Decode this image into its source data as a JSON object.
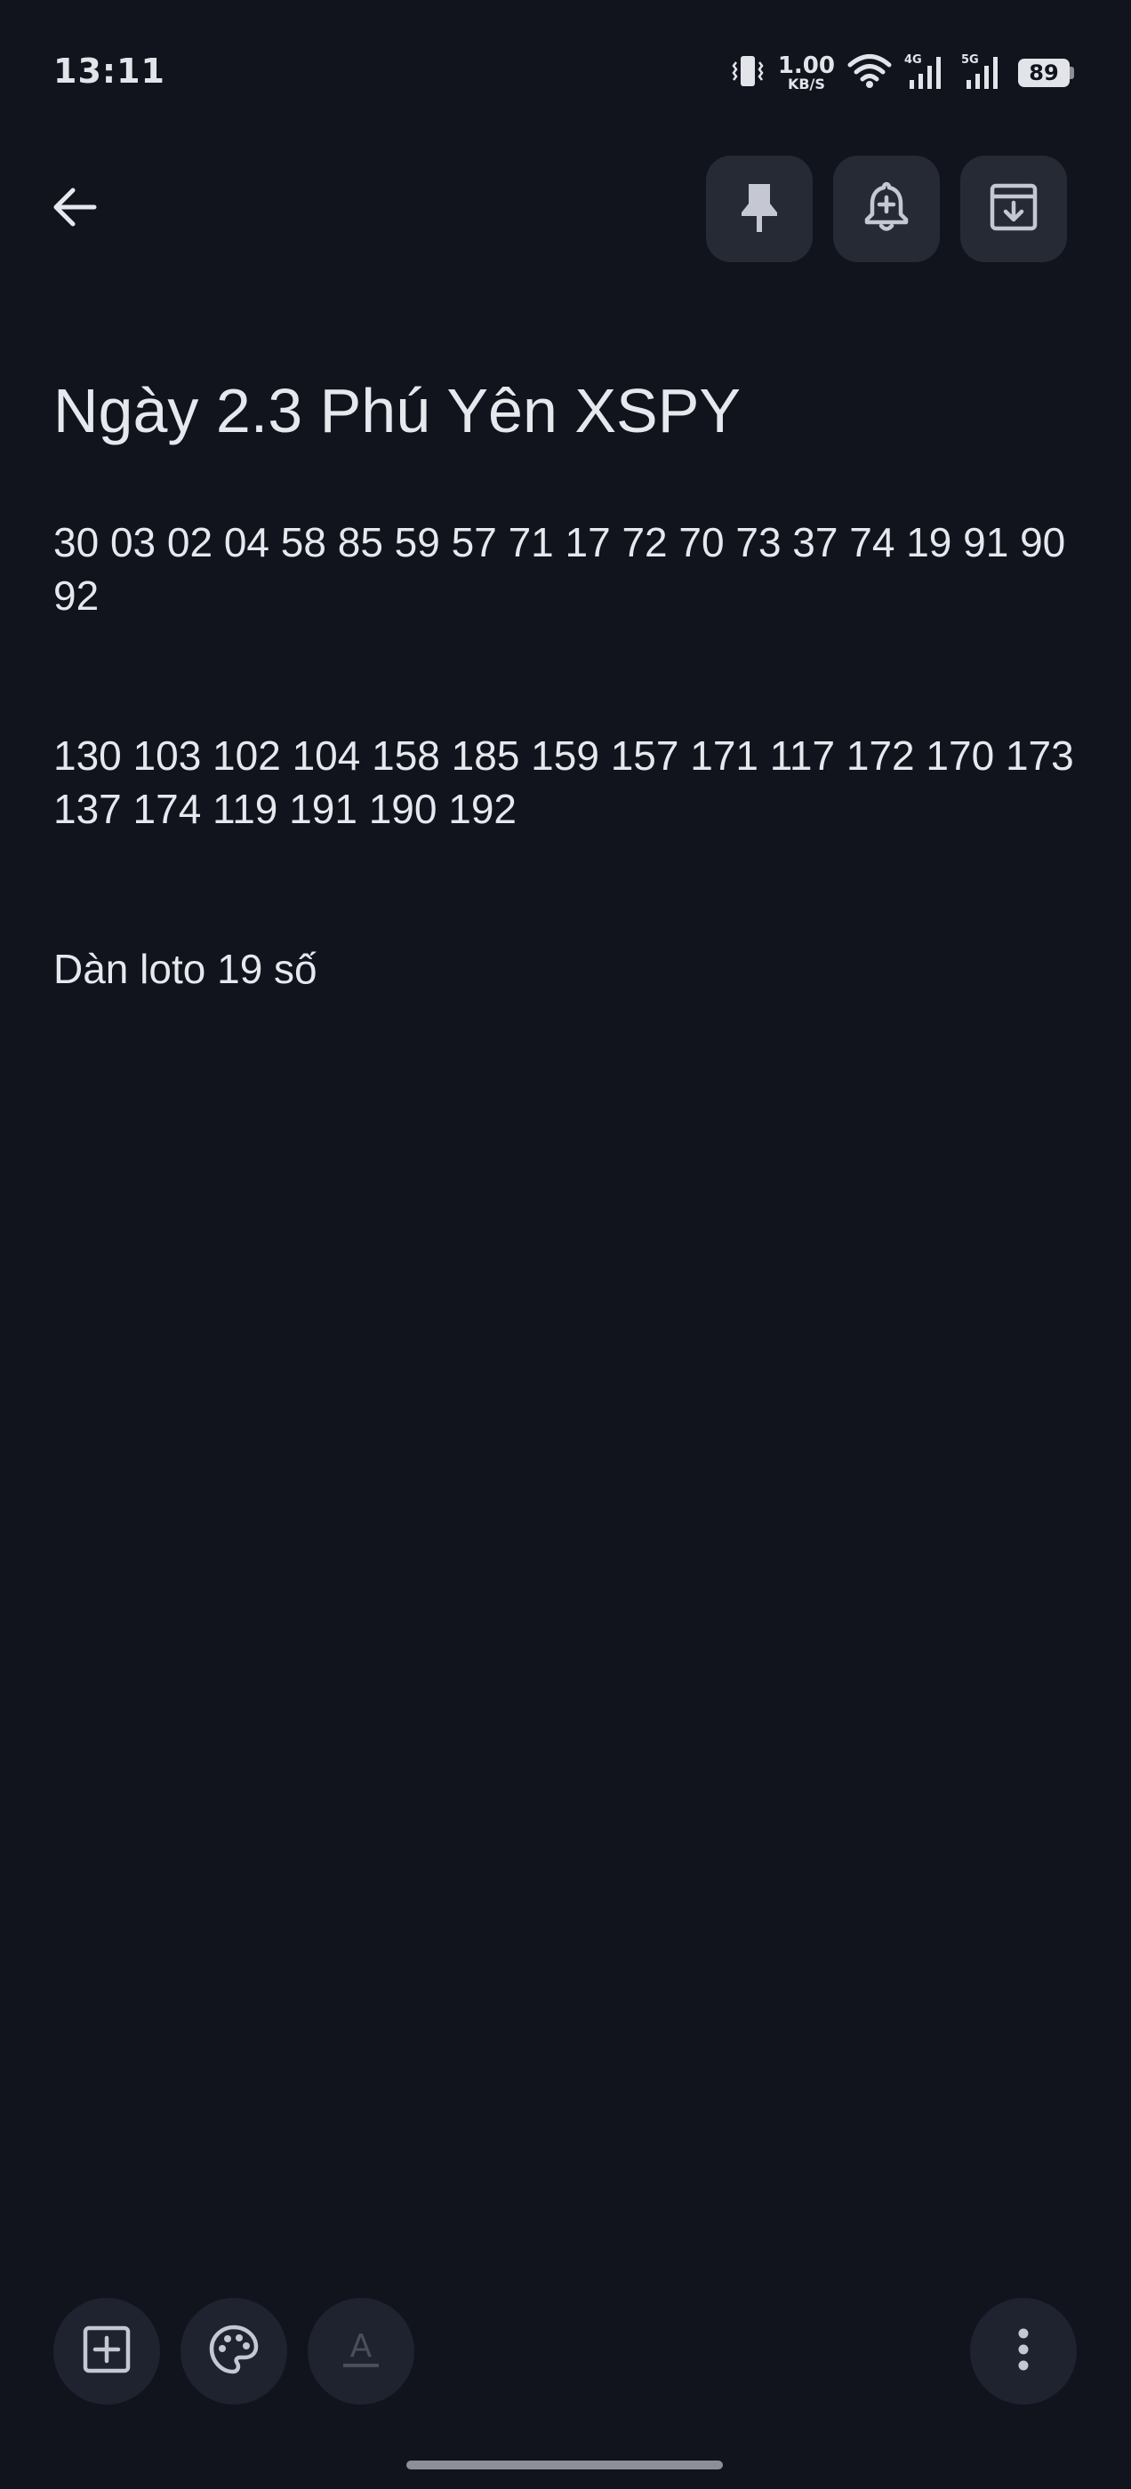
{
  "status_bar": {
    "time": "13:11",
    "net_speed_value": "1.00",
    "net_speed_unit": "KB/S",
    "signal_1_label": "4G",
    "signal_2_label": "5G",
    "battery_level": "89",
    "icons": [
      "vibrate-icon",
      "wifi-icon",
      "cell-signal-4g-icon",
      "cell-signal-5g-icon",
      "battery-icon"
    ]
  },
  "toolbar": {
    "icons": [
      "back-arrow-icon",
      "pin-icon",
      "bell-add-icon",
      "archive-icon"
    ]
  },
  "note": {
    "title": "Ngày 2.3 Phú Yên XSPY",
    "paragraphs": [
      "30 03 02 04 58 85 59 57 71 17 72 70 73 37 74 19 91 90 92",
      "130 103 102 104 158 185 159 157 171 117 172 170 173 137 174 119 191 190 192",
      "Dàn loto 19 số"
    ]
  },
  "bottom_bar": {
    "icons": [
      "add-box-icon",
      "palette-icon",
      "text-format-icon",
      "more-vert-icon"
    ],
    "format_label": "A"
  },
  "colors": {
    "background": "#11141d",
    "button_bg": "#262a35",
    "text": "#e6e8ee",
    "icon": "#c5c8d2",
    "disabled_icon": "#4a4e5a"
  }
}
